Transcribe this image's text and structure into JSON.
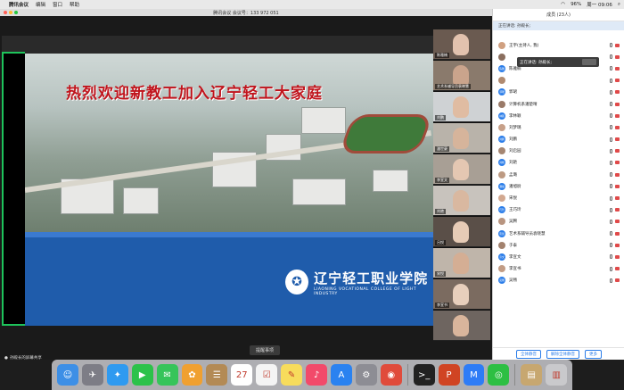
{
  "menubar": {
    "apple": "",
    "app_name": "腾讯会议",
    "items": [
      "编辑",
      "窗口",
      "帮助"
    ],
    "battery": "96%",
    "time": "周一 09:06"
  },
  "window": {
    "title": "腾讯会议 会议号：133 972 051"
  },
  "slide": {
    "headline": "热烈欢迎新教工加入辽宁轻工大家庭",
    "logo_cn": "辽宁轻工职业学院",
    "logo_en": "LIAONING VOCATIONAL COLLEGE OF LIGHT INDUSTRY"
  },
  "toolbar": {
    "note_label": "提醒事项"
  },
  "share_tag": {
    "text": "孙殿长的屏幕共享"
  },
  "videos": [
    {
      "label": "陈雅楠",
      "bg": "#6a5a50",
      "face": "#e2c2ae"
    },
    {
      "label": "艺术系辅导员袁晓慧",
      "bg": "#8a7a6c",
      "face": "#caa48c"
    },
    {
      "label": "刘鹏",
      "bg": "#cfd2d4",
      "face": "#e0bca2"
    },
    {
      "label": "潘世豪",
      "bg": "#b9b3aa",
      "face": "#d6b49b"
    },
    {
      "label": "李宣文",
      "bg": "#a89f95",
      "face": "#e4c7b2"
    },
    {
      "label": "刘艳",
      "bg": "#c8c3bd",
      "face": "#d9b8a0"
    },
    {
      "label": "吕悦",
      "bg": "#5a4f48",
      "face": "#e6cbb6"
    },
    {
      "label": "宋悦",
      "bg": "#bfb5aa",
      "face": "#d4ae94"
    },
    {
      "label": "李宣书",
      "bg": "#7b6b60",
      "face": "#e8cfbc"
    },
    {
      "label": "",
      "bg": "#6e6560",
      "face": "#d9b59c"
    }
  ],
  "panel": {
    "title": "成员 (23人)",
    "speaking": "正在讲话: 孙殿长;",
    "tooltip": "正在讲话: 孙殿长;",
    "members": [
      {
        "name": "王宇(主持人, 我)",
        "color": "#d0a080"
      },
      {
        "name": "",
        "color": "#8a6e5e"
      },
      {
        "name": "陈雅楠",
        "color": "#2b7de9",
        "av": "陈雅"
      },
      {
        "name": "",
        "color": "#b08a70"
      },
      {
        "name": "郭珺",
        "color": "#2b7de9",
        "av": "郭珺"
      },
      {
        "name": "计算机系潘楚晴",
        "color": "#9a7a68"
      },
      {
        "name": "李林颖",
        "color": "#2b7de9",
        "av": "林颖"
      },
      {
        "name": "刘梦璐",
        "color": "#c7a089"
      },
      {
        "name": "刘鹏",
        "color": "#2b7de9",
        "av": "刘鹏"
      },
      {
        "name": "刘启园",
        "color": "#a58672"
      },
      {
        "name": "刘艳",
        "color": "#2b7de9",
        "av": "刘艳"
      },
      {
        "name": "孟璐",
        "color": "#bd9a82"
      },
      {
        "name": "潘旭尉",
        "color": "#2b7de9",
        "av": "潘旭"
      },
      {
        "name": "宋悦",
        "color": "#d2a890"
      },
      {
        "name": "王巧玲",
        "color": "#2b7de9",
        "av": "巧玲"
      },
      {
        "name": "吴腾",
        "color": "#b89580"
      },
      {
        "name": "艺术系辅导员袁晓慧",
        "color": "#2b7de9",
        "av": "晓慧"
      },
      {
        "name": "于泰",
        "color": "#a3826e"
      },
      {
        "name": "李宣文",
        "color": "#2b7de9",
        "av": "宣文"
      },
      {
        "name": "李宣书",
        "color": "#c29c85"
      },
      {
        "name": "吴畅",
        "color": "#2b7de9",
        "av": "吴畅"
      }
    ],
    "mute_all": "全体静音",
    "unmute_all": "解除全体静音",
    "more": "更多"
  },
  "dock": [
    {
      "name": "finder-icon",
      "color": "#3d8fe6",
      "glyph": "☺"
    },
    {
      "name": "launchpad-icon",
      "color": "#7d7d86",
      "glyph": "✈"
    },
    {
      "name": "safari-icon",
      "color": "#2f9af0",
      "glyph": "✦"
    },
    {
      "name": "facetime-icon",
      "color": "#2cc24a",
      "glyph": "▶"
    },
    {
      "name": "messages-icon",
      "color": "#36c45a",
      "glyph": "✉"
    },
    {
      "name": "photos-icon",
      "color": "#f0a030",
      "glyph": "✿"
    },
    {
      "name": "contacts-icon",
      "color": "#b38a55",
      "glyph": "☰"
    },
    {
      "name": "calendar-icon",
      "color": "#ffffff",
      "glyph": "27"
    },
    {
      "name": "reminders-icon",
      "color": "#f4f4f4",
      "glyph": "☑"
    },
    {
      "name": "notes-icon",
      "color": "#f7dc5c",
      "glyph": "✎"
    },
    {
      "name": "music-icon",
      "color": "#f24a6a",
      "glyph": "♪"
    },
    {
      "name": "appstore-icon",
      "color": "#2a82f0",
      "glyph": "A"
    },
    {
      "name": "preferences-icon",
      "color": "#8d8d94",
      "glyph": "⚙"
    },
    {
      "name": "chrome-icon",
      "color": "#e04b3b",
      "glyph": "◉"
    },
    {
      "name": "terminal-icon",
      "color": "#222222",
      "glyph": ">_"
    },
    {
      "name": "powerpoint-icon",
      "color": "#d04423",
      "glyph": "P"
    },
    {
      "name": "tencent-meeting-icon",
      "color": "#2e7cf6",
      "glyph": "M"
    },
    {
      "name": "wechat-icon",
      "color": "#2dbf43",
      "glyph": "◎"
    },
    {
      "name": "folder-icon",
      "color": "#c7a770",
      "glyph": "▤"
    },
    {
      "name": "trash-icon",
      "color": "#c9c9cc",
      "glyph": "▥"
    }
  ]
}
